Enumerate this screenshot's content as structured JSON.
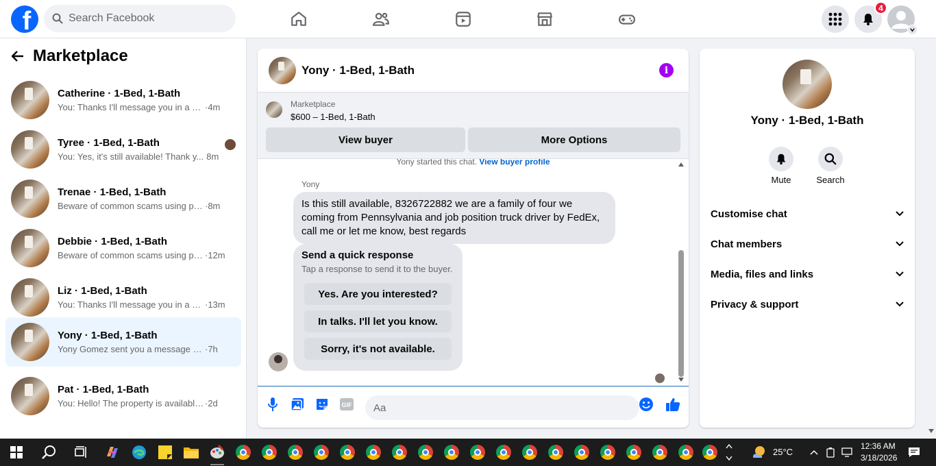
{
  "topbar": {
    "search_placeholder": "Search Facebook",
    "notifications_count": "4",
    "logo_letter": "f"
  },
  "sidebar": {
    "title": "Marketplace",
    "conversations": [
      {
        "name": "Catherine · 1-Bed, 1-Bath",
        "message": "You: Thanks I'll message you in a mo...",
        "time": "·4m"
      },
      {
        "name": "Tyree · 1-Bed, 1-Bath",
        "message": "You: Yes, it's still available! Thank y...",
        "time": "8m"
      },
      {
        "name": "Trenae · 1-Bed, 1-Bath",
        "message": "Beware of common scams using pay...",
        "time": "·8m"
      },
      {
        "name": "Debbie · 1-Bed, 1-Bath",
        "message": "Beware of common scams using pa...",
        "time": "·12m"
      },
      {
        "name": "Liz · 1-Bed, 1-Bath",
        "message": "You: Thanks I'll message you in a m...",
        "time": "·13m"
      },
      {
        "name": "Yony · 1-Bed, 1-Bath",
        "message": "Yony Gomez sent you a message abo...",
        "time": "·7h"
      },
      {
        "name": "Pat · 1-Bed, 1-Bath",
        "message": "You: Hello! The property is available. A...",
        "time": "·2d"
      }
    ]
  },
  "chat": {
    "title": "Yony · 1-Bed, 1-Bath",
    "marketplace_label": "Marketplace",
    "listing": "$600 – 1-Bed, 1-Bath",
    "view_buyer": "View buyer",
    "more_options": "More Options",
    "started_text": "Yony started this chat.",
    "view_buyer_profile": "View buyer profile",
    "sender": "Yony",
    "message": "Is this still available, 8326722882 we are a family of four we coming from Pennsylvania and job position truck driver by FedEx, call me or let me know, best regards",
    "quick_title": "Send a quick response",
    "quick_sub": "Tap a response to send it to the buyer.",
    "quick_replies": [
      "Yes. Are you interested?",
      "In talks. I'll let you know.",
      "Sorry, it's not available."
    ],
    "composer_placeholder": "Aa"
  },
  "details": {
    "name": "Yony · 1-Bed, 1-Bath",
    "mute": "Mute",
    "search": "Search",
    "sections": [
      "Customise chat",
      "Chat members",
      "Media, files and links",
      "Privacy & support"
    ]
  },
  "taskbar": {
    "temperature": "25°C",
    "time": "12:36 AM",
    "date": "3/18/2026"
  },
  "colors": {
    "facebook_blue": "#0866ff",
    "info_purple": "#a200f5",
    "notification_red": "#e41e3f",
    "active_bg": "#ebf5ff"
  }
}
